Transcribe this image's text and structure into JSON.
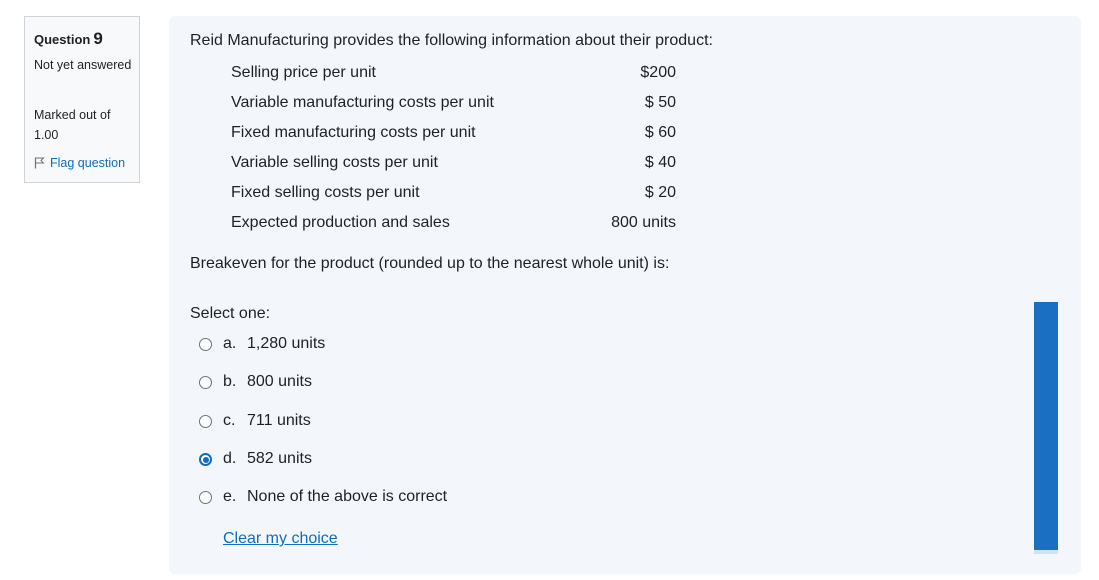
{
  "info": {
    "question_label": "Question",
    "question_number": "9",
    "status": "Not yet answered",
    "marks": "Marked out of 1.00",
    "flag_label": "Flag question"
  },
  "question": {
    "intro": "Reid Manufacturing provides the following information about their product:",
    "rows": [
      {
        "label": "Selling price per unit",
        "value": "$200"
      },
      {
        "label": "Variable manufacturing costs per unit",
        "value": "$ 50"
      },
      {
        "label": "Fixed manufacturing costs per unit",
        "value": "$ 60"
      },
      {
        "label": "Variable selling costs per unit",
        "value": "$ 40"
      },
      {
        "label": "Fixed selling costs per unit",
        "value": "$ 20"
      },
      {
        "label": "Expected production and sales",
        "value": "800 units"
      }
    ],
    "prompt": "Breakeven for the product (rounded up to the nearest whole unit) is:",
    "select_label": "Select one:",
    "answers": [
      {
        "letter": "a.",
        "text": "1,280 units",
        "selected": false
      },
      {
        "letter": "b.",
        "text": "800 units",
        "selected": false
      },
      {
        "letter": "c.",
        "text": "711 units",
        "selected": false
      },
      {
        "letter": "d.",
        "text": "582 units",
        "selected": true
      },
      {
        "letter": "e.",
        "text": "None of the above is correct",
        "selected": false
      }
    ],
    "clear_label": "Clear my choice"
  },
  "colors": {
    "accent": "#0f6cbf",
    "panel_bg": "#f3f6fa",
    "scrollbar": "#1a6fc2"
  }
}
